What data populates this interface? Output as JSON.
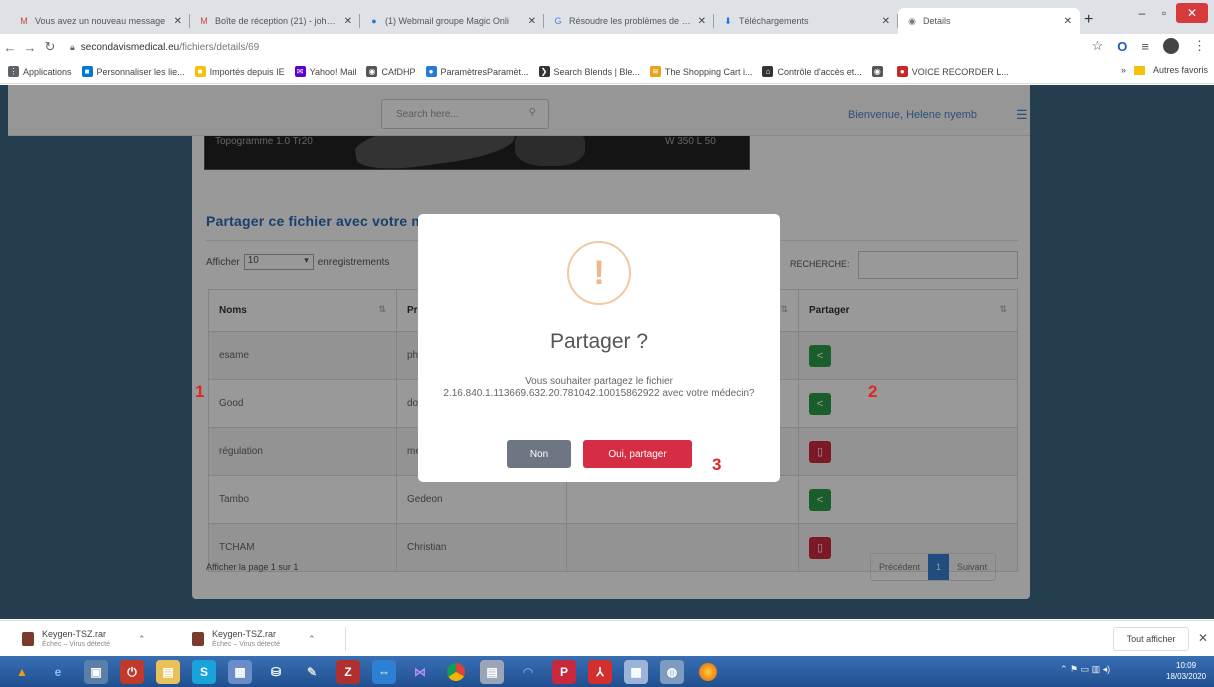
{
  "browser": {
    "tabs": [
      {
        "label": "Vous avez un nouveau message",
        "icon": "gmail-icon",
        "color": "#d44638",
        "glyph": "M"
      },
      {
        "label": "Boîte de réception (21) - johann",
        "icon": "gmail-icon",
        "color": "#d44638",
        "glyph": "M"
      },
      {
        "label": "(1) Webmail groupe Magic Onli",
        "icon": "webmail-icon",
        "color": "#2b7bd6",
        "glyph": "●"
      },
      {
        "label": "Résoudre les problèmes de télé",
        "icon": "google-icon",
        "color": "#4285f4",
        "glyph": "G"
      },
      {
        "label": "Téléchargements",
        "icon": "download-icon",
        "color": "#1a73e8",
        "glyph": "⬇"
      },
      {
        "label": "Details",
        "icon": "globe-icon",
        "color": "#777",
        "glyph": "◉"
      }
    ],
    "url_host": "secondavismedical.eu",
    "url_path": "/fichiers/details/69",
    "bookmarks": [
      {
        "label": "Applications",
        "color": "#5f6368",
        "glyph": "⋮"
      },
      {
        "label": "Personnaliser les lie...",
        "color": "#0078d7",
        "glyph": "■"
      },
      {
        "label": "Importés depuis IE",
        "color": "#f4c20d",
        "glyph": "■"
      },
      {
        "label": "Yahoo! Mail",
        "color": "#6001d2",
        "glyph": "✉"
      },
      {
        "label": "CAfDHP",
        "color": "#555",
        "glyph": "◉"
      },
      {
        "label": "ParamètresParamèt...",
        "color": "#2b7bd6",
        "glyph": "●"
      },
      {
        "label": "Search Blends | Ble...",
        "color": "#333",
        "glyph": "❯"
      },
      {
        "label": "The Shopping Cart i...",
        "color": "#e8a317",
        "glyph": "≋"
      },
      {
        "label": "Contrôle d'accès et...",
        "color": "#333",
        "glyph": "⌂"
      },
      {
        "label": "",
        "color": "#555",
        "glyph": "◉"
      },
      {
        "label": "VOICE RECORDER L...",
        "color": "#c62828",
        "glyph": "●"
      }
    ],
    "bookmarks_more": "»",
    "other_bookmarks": "Autres favoris"
  },
  "header": {
    "search_placeholder": "Search here...",
    "welcome": "Bienvenue, Helene nyemb"
  },
  "image": {
    "left_label": "Topogramme 1.0 Tr20",
    "right_label": "W 350 L 50"
  },
  "section": {
    "title": "Partager ce fichier avec votre médecin"
  },
  "table_controls": {
    "show_label": "Afficher",
    "page_length": "10",
    "records_label": "enregistrements",
    "search_label": "RECHERCHE:"
  },
  "table": {
    "headers": [
      "Noms",
      "Prénoms",
      "",
      "Partager"
    ],
    "rows": [
      {
        "nom": "esame",
        "prenom": "physi",
        "status": "share"
      },
      {
        "nom": "Good",
        "prenom": "docto",
        "status": "share"
      },
      {
        "nom": "régulation",
        "prenom": "médi",
        "status": "unshare"
      },
      {
        "nom": "Tambo",
        "prenom": "Gedeon",
        "status": "share"
      },
      {
        "nom": "TCHAM",
        "prenom": "Christian",
        "status": "unshare"
      }
    ]
  },
  "pagination": {
    "info": "Afficher la page 1 sur 1",
    "prev": "Précédent",
    "current": "1",
    "next": "Suivant"
  },
  "modal": {
    "title": "Partager ?",
    "message": "Vous souhaiter partagez le fichier 2.16.840.1.113669.632.20.781042.10015862922 avec votre médecin?",
    "cancel": "Non",
    "confirm": "Oui, partager"
  },
  "annotations": [
    "1",
    "2",
    "3"
  ],
  "downloads": {
    "items": [
      {
        "name": "Keygen-TSZ.rar",
        "status": "Échec – Virus détecté"
      },
      {
        "name": "Keygen-TSZ.rar",
        "status": "Échec – Virus détecté"
      }
    ],
    "show_all": "Tout afficher"
  },
  "taskbar": {
    "time": "10:09",
    "date": "18/03/2020"
  },
  "colors": {
    "page_bg": "#3c6684",
    "brand_blue": "#2a6bb5",
    "share_green": "#2e9c4a",
    "unshare_red": "#cf2b3c",
    "confirm_red": "#d52d44"
  }
}
